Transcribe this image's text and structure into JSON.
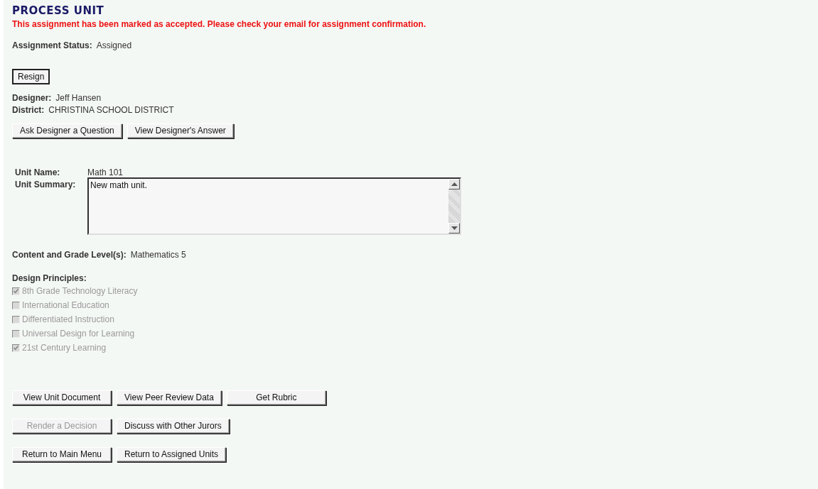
{
  "title": "PROCESS UNIT",
  "message": "This assignment has been marked as accepted. Please check your email for assignment confirmation.",
  "assignment_status": {
    "label": "Assignment Status:",
    "value": "Assigned"
  },
  "resign_button": {
    "label": "Resign",
    "disabled": false
  },
  "designer": {
    "label": "Designer:",
    "value": "Jeff Hansen"
  },
  "district": {
    "label": "District:",
    "value": "CHRISTINA SCHOOL DISTRICT"
  },
  "designer_buttons": [
    {
      "label": "Ask Designer a Question",
      "disabled": false
    },
    {
      "label": "View Designer's Answer",
      "disabled": false
    }
  ],
  "unit_name": {
    "label": "Unit Name:",
    "value": "Math 101"
  },
  "unit_summary": {
    "label": "Unit Summary:",
    "value": "New math unit."
  },
  "content_grade": {
    "label": "Content and Grade Level(s):",
    "value": "Mathematics 5"
  },
  "design_principles": {
    "label": "Design Principles:",
    "items": [
      {
        "label": "8th Grade Technology Literacy",
        "checked": true,
        "disabled": true
      },
      {
        "label": "International Education",
        "checked": false,
        "disabled": true
      },
      {
        "label": "Differentiated Instruction",
        "checked": false,
        "disabled": true
      },
      {
        "label": "Universal Design for Learning",
        "checked": false,
        "disabled": true
      },
      {
        "label": "21st Century Learning",
        "checked": true,
        "disabled": true
      }
    ]
  },
  "action_rows": [
    [
      {
        "label": "View Unit Document",
        "disabled": false
      },
      {
        "label": "View Peer Review Data",
        "disabled": false
      },
      {
        "label": "Get Rubric",
        "disabled": false
      }
    ],
    [
      {
        "label": "Render a Decision",
        "disabled": true
      },
      {
        "label": "Discuss with Other Jurors",
        "disabled": false
      }
    ],
    [
      {
        "label": "Return to Main Menu",
        "disabled": false
      },
      {
        "label": "Return to Assigned Units",
        "disabled": false
      }
    ]
  ]
}
